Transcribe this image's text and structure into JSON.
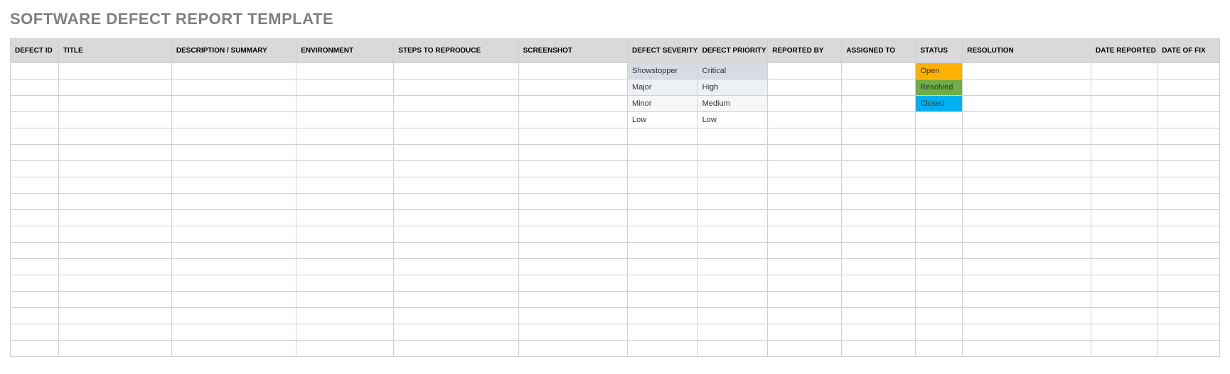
{
  "title": "SOFTWARE DEFECT REPORT TEMPLATE",
  "columns": [
    "DEFECT ID",
    "TITLE",
    "DESCRIPTION / SUMMARY",
    "ENVIRONMENT",
    "STEPS TO REPRODUCE",
    "SCREENSHOT",
    "DEFECT SEVERITY",
    "DEFECT PRIORITY",
    "REPORTED BY",
    "ASSIGNED TO",
    "STATUS",
    "RESOLUTION",
    "DATE REPORTED",
    "DATE OF FIX"
  ],
  "prefill": {
    "severity": [
      "Showstopper",
      "Major",
      "Minor",
      "Low"
    ],
    "priority": [
      "Critical",
      "High",
      "Medium",
      "Low"
    ],
    "status": [
      "Open",
      "Resolved",
      "Closed"
    ]
  },
  "empty_row_count": 18
}
